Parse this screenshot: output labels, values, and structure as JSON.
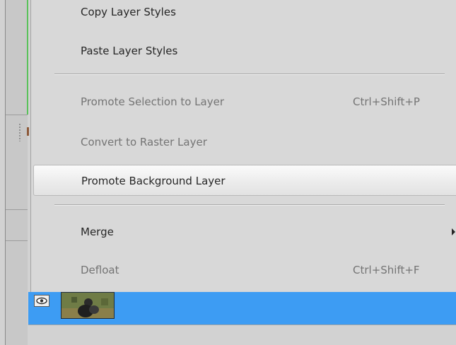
{
  "menu": {
    "items": [
      {
        "label": "Copy Layer Styles",
        "shortcut": "",
        "enabled": true
      },
      {
        "label": "Paste Layer Styles",
        "shortcut": "",
        "enabled": true
      },
      {
        "label": "Promote Selection to Layer",
        "shortcut": "Ctrl+Shift+P",
        "enabled": false
      },
      {
        "label": "Convert to Raster Layer",
        "shortcut": "",
        "enabled": false
      },
      {
        "label": "Promote Background Layer",
        "shortcut": "",
        "enabled": true,
        "highlighted": true
      },
      {
        "label": "Merge",
        "shortcut": "",
        "enabled": true,
        "submenu": true
      },
      {
        "label": "Defloat",
        "shortcut": "Ctrl+Shift+F",
        "enabled": false
      }
    ]
  },
  "layers": {
    "selected": {
      "visible": true,
      "eye_icon": "eye-icon",
      "thumbnail": "photo-thumbnail"
    }
  },
  "colors": {
    "selection": "#3d9cf3",
    "menu_bg": "#d8d8d8",
    "disabled_text": "#747474",
    "accent_green": "#59c25a"
  }
}
